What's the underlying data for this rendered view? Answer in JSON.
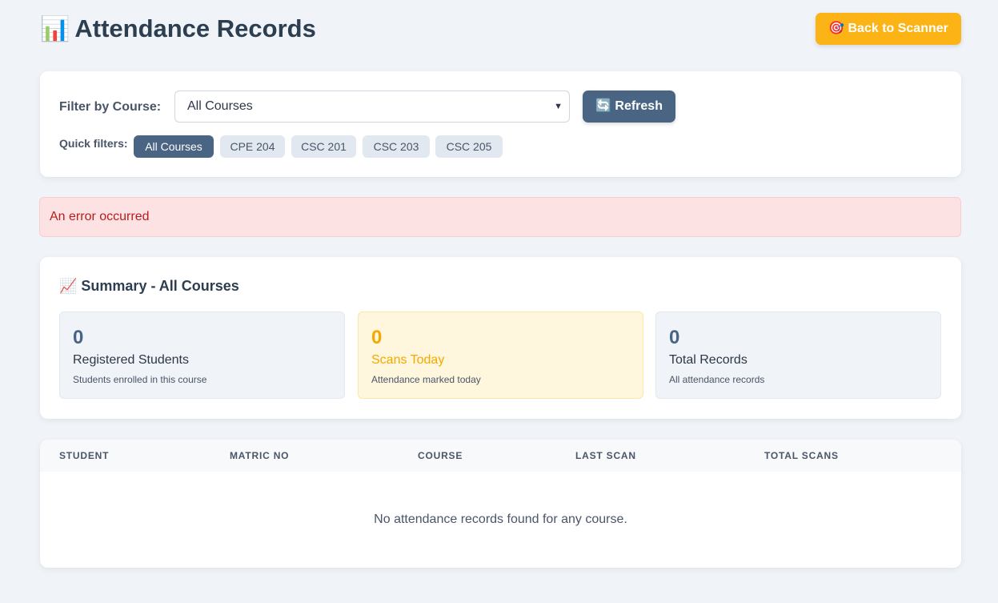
{
  "header": {
    "title_emoji": "📊",
    "title": "Attendance Records",
    "back_button": "🎯 Back to Scanner"
  },
  "filter": {
    "label": "Filter by Course:",
    "selected_course": "All Courses",
    "refresh_button": "🔄 Refresh",
    "quick_label": "Quick filters:",
    "quick_filters": [
      "All Courses",
      "CPE 204",
      "CSC 201",
      "CSC 203",
      "CSC 205"
    ],
    "active_quick_filter": "All Courses"
  },
  "error": {
    "message": "An error occurred"
  },
  "summary": {
    "title": "📈 Summary - All Courses",
    "stats": [
      {
        "value": "0",
        "label": "Registered Students",
        "sub": "Students enrolled in this course"
      },
      {
        "value": "0",
        "label": "Scans Today",
        "sub": "Attendance marked today"
      },
      {
        "value": "0",
        "label": "Total Records",
        "sub": "All attendance records"
      }
    ]
  },
  "table": {
    "columns": [
      "STUDENT",
      "MATRIC NO",
      "COURSE",
      "LAST SCAN",
      "TOTAL SCANS"
    ],
    "empty_message": "No attendance records found for any course."
  },
  "colors": {
    "primary": "#4a6484",
    "accent": "#fbb316",
    "error_bg": "#fde2e4",
    "error_text": "#b91c1c",
    "warn_bg": "#fef7dd"
  }
}
